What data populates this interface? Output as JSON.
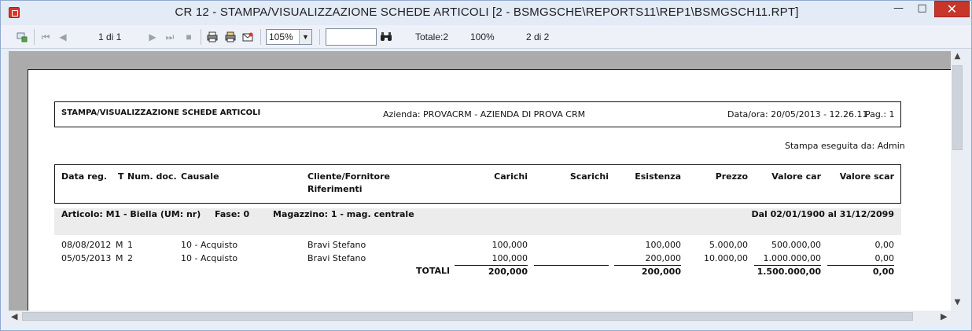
{
  "window": {
    "title": "CR 12 - STAMPA/VISUALIZZAZIONE SCHEDE ARTICOLI [2 - BSMGSCHE\\REPORTS11\\REP1\\BSMGSCH11.RPT]",
    "min_glyph": "—",
    "max_glyph": "□",
    "close_glyph": "✕"
  },
  "toolbar": {
    "page_indicator": "1 di 1",
    "zoom": "105%",
    "search_value": "",
    "totale": "Totale:2",
    "percent": "100%",
    "records": "2 di 2"
  },
  "report": {
    "title": "STAMPA/VISUALIZZAZIONE SCHEDE ARTICOLI",
    "azienda": "Azienda: PROVACRM - AZIENDA DI PROVA CRM",
    "dataora": "Data/ora: 20/05/2013 - 12.26.11",
    "pag": "Pag.: 1",
    "stampa": "Stampa eseguita da: Admin",
    "columns": {
      "data_reg": "Data reg.",
      "t": "T",
      "num_doc": "Num. doc.",
      "causale": "Causale",
      "cliente": "Cliente/Fornitore",
      "riferimenti": "Riferimenti",
      "carichi": "Carichi",
      "scarichi": "Scarichi",
      "esistenza": "Esistenza",
      "prezzo": "Prezzo",
      "valore_car": "Valore car",
      "valore_scar": "Valore scar"
    },
    "group": {
      "articolo": "Articolo: M1 - Biella (UM: nr)",
      "fase": "Fase: 0",
      "magazzino": "Magazzino: 1 - mag. centrale",
      "periodo": "Dal 02/01/1900 al 31/12/2099"
    },
    "rows": [
      {
        "data": "08/08/2012",
        "t": "M",
        "num": "1",
        "causale": "10 - Acquisto",
        "cliente": "Bravi Stefano",
        "carichi": "100,000",
        "scarichi": "",
        "esistenza": "100,000",
        "prezzo": "5.000,00",
        "valore_car": "500.000,00",
        "valore_scar": "0,00"
      },
      {
        "data": "05/05/2013",
        "t": "M",
        "num": "2",
        "causale": "10 - Acquisto",
        "cliente": "Bravi Stefano",
        "carichi": "100,000",
        "scarichi": "",
        "esistenza": "200,000",
        "prezzo": "10.000,00",
        "valore_car": "1.000.000,00",
        "valore_scar": "0,00"
      }
    ],
    "totals": {
      "label": "TOTALI",
      "carichi": "200,000",
      "esistenza": "200,000",
      "valore_car": "1.500.000,00",
      "valore_scar": "0,00"
    }
  }
}
